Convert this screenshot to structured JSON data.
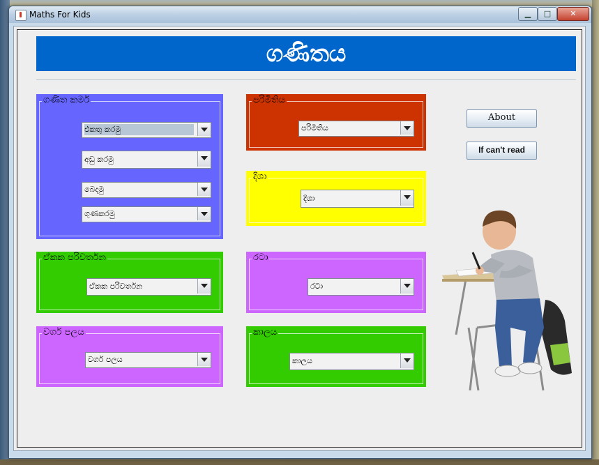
{
  "window": {
    "title": "Maths For Kids"
  },
  "header": {
    "title": "ගණිතය"
  },
  "panels": {
    "ganitha_karma": {
      "legend": "ගණිත කර්ම",
      "color": "#6666ff",
      "combos": [
        "එකතු කරමු",
        "අඩු කරමු",
        "බෙදමු",
        "ගුණකරමු"
      ]
    },
    "parimithiya": {
      "legend": "පරිමිතිය",
      "color": "#cc3300",
      "combo": "පරිමිතිය"
    },
    "disha": {
      "legend": "දිශා",
      "color": "#ffff00",
      "combo": "දිශා"
    },
    "ekaka": {
      "legend": "ඒකක පරිවර්තන",
      "color": "#33cc00",
      "combo": "ඒකක පරිවර්තන"
    },
    "rata": {
      "legend": "රටා",
      "color": "#cc66ff",
      "combo": "රටා"
    },
    "warga": {
      "legend": "වර්ග පලය",
      "color": "#cc66ff",
      "combo": "වර්ග පලය"
    },
    "kalaya": {
      "legend": "කාලය",
      "color": "#33cc00",
      "combo": "කාලය"
    }
  },
  "buttons": {
    "about": "About",
    "cant_read": "If can't read"
  },
  "icons": [
    "java-app-icon",
    "minimize-icon",
    "maximize-icon",
    "close-icon",
    "dropdown-arrow-icon",
    "boy-studying-image"
  ]
}
